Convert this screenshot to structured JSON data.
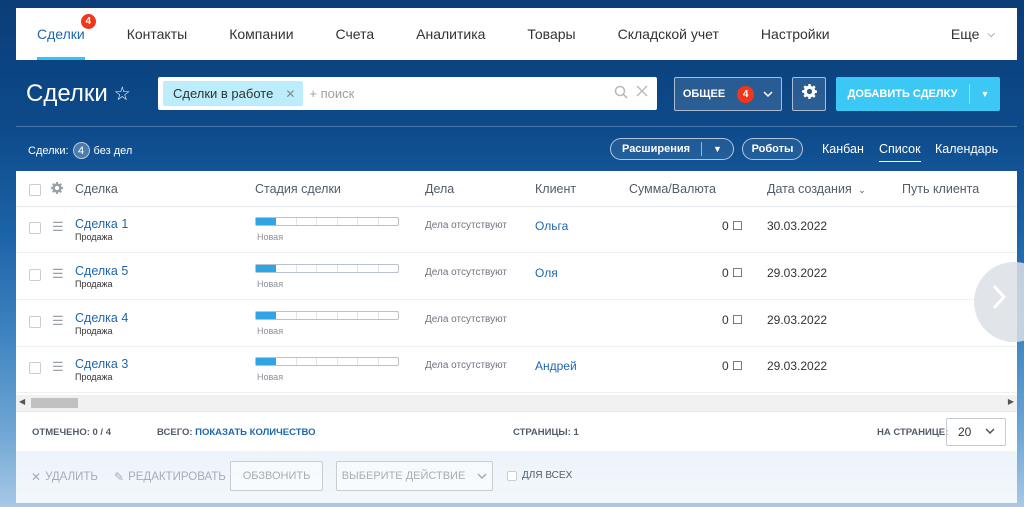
{
  "topnav": {
    "items": [
      {
        "label": "Сделки",
        "badge": "4",
        "active": true
      },
      {
        "label": "Контакты"
      },
      {
        "label": "Компании"
      },
      {
        "label": "Счета"
      },
      {
        "label": "Аналитика"
      },
      {
        "label": "Товары"
      },
      {
        "label": "Складской учет"
      },
      {
        "label": "Настройки"
      }
    ],
    "more_label": "Еще"
  },
  "header": {
    "title": "Сделки",
    "filter_chip": "Сделки в работе",
    "search_placeholder": "+ поиск",
    "general_label": "ОБЩЕЕ",
    "general_badge": "4",
    "add_label": "ДОБАВИТЬ СДЕЛКУ"
  },
  "toolbar": {
    "counter_prefix": "Сделки:",
    "counter_value": "4",
    "counter_suffix": "без дел",
    "extensions_label": "Расширения",
    "robots_label": "Роботы",
    "views": [
      "Канбан",
      "Список",
      "Календарь"
    ],
    "active_view": "Список"
  },
  "grid": {
    "columns": [
      "Сделка",
      "Стадия сделки",
      "Дела",
      "Клиент",
      "Сумма/Валюта",
      "Дата создания",
      "Путь клиента"
    ],
    "rows": [
      {
        "name": "Сделка 1",
        "category": "Продажа",
        "stage": "Новая",
        "stage_progress": 1,
        "stage_total": 7,
        "deals": "Дела отсутствуют",
        "client": "Ольга",
        "sum": "0 ☐",
        "date": "30.03.2022"
      },
      {
        "name": "Сделка 5",
        "category": "Продажа",
        "stage": "Новая",
        "stage_progress": 1,
        "stage_total": 7,
        "deals": "Дела отсутствуют",
        "client": "Оля",
        "sum": "0 ☐",
        "date": "29.03.2022"
      },
      {
        "name": "Сделка 4",
        "category": "Продажа",
        "stage": "Новая",
        "stage_progress": 1,
        "stage_total": 7,
        "deals": "Дела отсутствуют",
        "client": "",
        "sum": "0 ☐",
        "date": "29.03.2022"
      },
      {
        "name": "Сделка 3",
        "category": "Продажа",
        "stage": "Новая",
        "stage_progress": 1,
        "stage_total": 7,
        "deals": "Дела отсутствуют",
        "client": "Андрей",
        "sum": "0 ☐",
        "date": "29.03.2022"
      }
    ]
  },
  "footer": {
    "marked_label": "ОТМЕЧЕНО: 0 / 4",
    "total_label": "ВСЕГО:",
    "total_link": "ПОКАЗАТЬ КОЛИЧЕСТВО",
    "pages_label": "СТРАНИЦЫ:",
    "pages_value": "1",
    "per_page_label": "НА СТРАНИЦЕ:",
    "per_page_value": "20"
  },
  "actions": {
    "delete_label": "УДАЛИТЬ",
    "edit_label": "РЕДАКТИРОВАТЬ",
    "call_label": "ОБЗВОНИТЬ",
    "choose_label": "ВЫБЕРИТЕ ДЕЙСТВИЕ",
    "for_all_label": "ДЛЯ ВСЕХ"
  },
  "colors": {
    "accent": "#3bc8f5",
    "link": "#2067b0",
    "badge": "#f0371b"
  }
}
